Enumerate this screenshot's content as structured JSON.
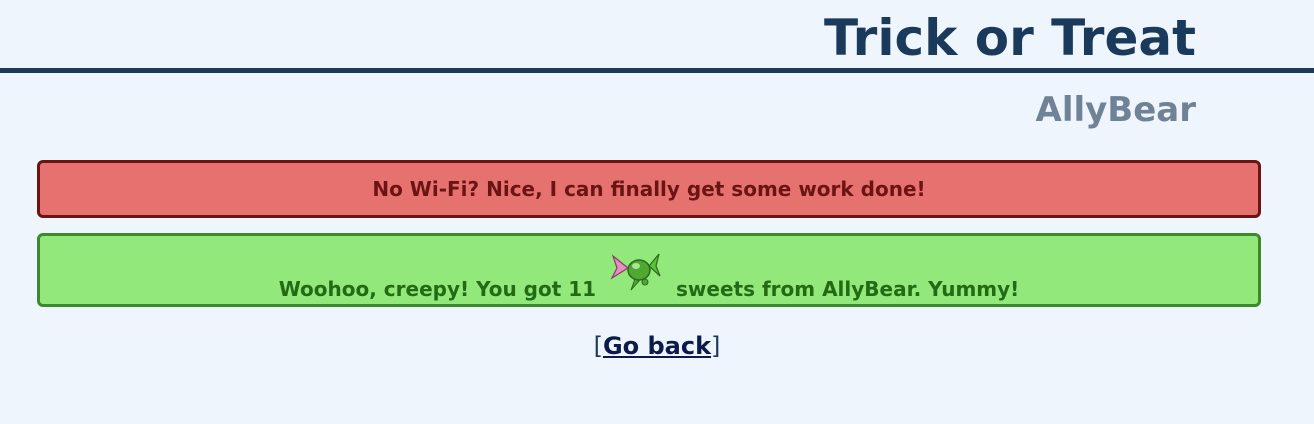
{
  "header": {
    "title": "Trick or Treat",
    "username": "AllyBear"
  },
  "messages": {
    "error": "No Wi-Fi? Nice, I can finally get some work done!",
    "success_prefix": "Woohoo, creepy! You got 11",
    "success_suffix": "sweets from AllyBear. Yummy!",
    "success_icon": "candy-icon"
  },
  "nav": {
    "bracket_open": "[",
    "back_label": "Go back",
    "bracket_close": "]"
  },
  "colors": {
    "background": "#eef5fd",
    "title": "#1a3a5c",
    "username": "#6f8296",
    "error_bg": "#e5726e",
    "error_text": "#6b1414",
    "success_bg": "#92e87a",
    "success_text": "#226b14"
  }
}
